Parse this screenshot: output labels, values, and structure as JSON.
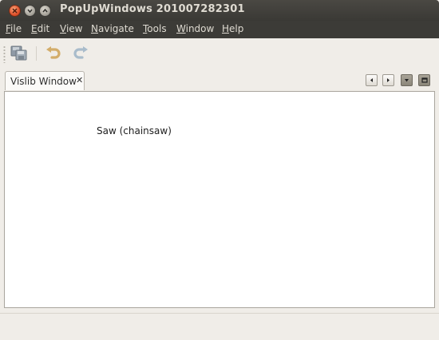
{
  "window": {
    "title": "PopUpWindows 201007282301"
  },
  "menubar": {
    "items": [
      {
        "mnemonic": "F",
        "rest": "ile"
      },
      {
        "mnemonic": "E",
        "rest": "dit"
      },
      {
        "mnemonic": "V",
        "rest": "iew"
      },
      {
        "mnemonic": "N",
        "rest": "avigate"
      },
      {
        "mnemonic": "T",
        "rest": "ools"
      },
      {
        "mnemonic": "W",
        "rest": "indow"
      },
      {
        "mnemonic": "H",
        "rest": "elp"
      }
    ]
  },
  "toolbar": {
    "icons": [
      "save-all-icon",
      "undo-icon",
      "redo-icon"
    ]
  },
  "tabs": {
    "active_label": "Vislib Window",
    "close_glyph": "✕"
  },
  "content": {
    "text": "Saw (chainsaw)"
  },
  "colors": {
    "titlebar": "#3c3b37",
    "close_button": "#e0512b",
    "background": "#f0ede8",
    "content_bg": "#ffffff"
  }
}
